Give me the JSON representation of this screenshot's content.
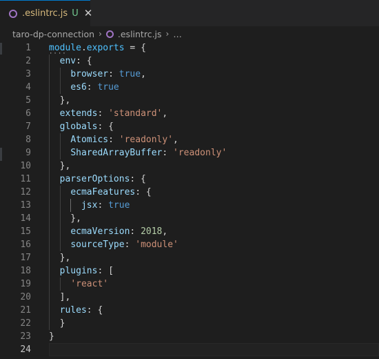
{
  "tab": {
    "icon": "eslint-circle-icon",
    "filename": ".eslintrc.js",
    "status": "U",
    "close_glyph": "✕",
    "color": "#d7ba7d"
  },
  "breadcrumb": {
    "folder": "taro-dp-connection",
    "file": ".eslintrc.js",
    "more": "…",
    "sep": "›"
  },
  "editor": {
    "current_line": 24,
    "lines": [
      {
        "n": "1",
        "tokens": [
          {
            "t": "module",
            "c": "v"
          },
          {
            "t": ".",
            "c": "w"
          },
          {
            "t": "exports",
            "c": "v"
          },
          {
            "t": " = {",
            "c": "w"
          }
        ]
      },
      {
        "n": "2",
        "tokens": [
          {
            "t": "  ",
            "c": "w"
          },
          {
            "t": "env",
            "c": "k"
          },
          {
            "t": ": {",
            "c": "w"
          }
        ]
      },
      {
        "n": "3",
        "tokens": [
          {
            "t": "    ",
            "c": "w"
          },
          {
            "t": "browser",
            "c": "k"
          },
          {
            "t": ": ",
            "c": "w"
          },
          {
            "t": "true",
            "c": "b"
          },
          {
            "t": ",",
            "c": "w"
          }
        ]
      },
      {
        "n": "4",
        "tokens": [
          {
            "t": "    ",
            "c": "w"
          },
          {
            "t": "es6",
            "c": "k"
          },
          {
            "t": ": ",
            "c": "w"
          },
          {
            "t": "true",
            "c": "b"
          }
        ]
      },
      {
        "n": "5",
        "tokens": [
          {
            "t": "  },",
            "c": "w"
          }
        ]
      },
      {
        "n": "6",
        "tokens": [
          {
            "t": "  ",
            "c": "w"
          },
          {
            "t": "extends",
            "c": "k"
          },
          {
            "t": ": ",
            "c": "w"
          },
          {
            "t": "'standard'",
            "c": "s"
          },
          {
            "t": ",",
            "c": "w"
          }
        ]
      },
      {
        "n": "7",
        "tokens": [
          {
            "t": "  ",
            "c": "w"
          },
          {
            "t": "globals",
            "c": "k"
          },
          {
            "t": ": {",
            "c": "w"
          }
        ]
      },
      {
        "n": "8",
        "tokens": [
          {
            "t": "    ",
            "c": "w"
          },
          {
            "t": "Atomics",
            "c": "k"
          },
          {
            "t": ": ",
            "c": "w"
          },
          {
            "t": "'readonly'",
            "c": "s"
          },
          {
            "t": ",",
            "c": "w"
          }
        ]
      },
      {
        "n": "9",
        "tokens": [
          {
            "t": "    ",
            "c": "w"
          },
          {
            "t": "SharedArrayBuffer",
            "c": "k"
          },
          {
            "t": ": ",
            "c": "w"
          },
          {
            "t": "'readonly'",
            "c": "s"
          }
        ]
      },
      {
        "n": "10",
        "tokens": [
          {
            "t": "  },",
            "c": "w"
          }
        ]
      },
      {
        "n": "11",
        "tokens": [
          {
            "t": "  ",
            "c": "w"
          },
          {
            "t": "parserOptions",
            "c": "k"
          },
          {
            "t": ": {",
            "c": "w"
          }
        ]
      },
      {
        "n": "12",
        "tokens": [
          {
            "t": "    ",
            "c": "w"
          },
          {
            "t": "ecmaFeatures",
            "c": "k"
          },
          {
            "t": ": {",
            "c": "w"
          }
        ]
      },
      {
        "n": "13",
        "tokens": [
          {
            "t": "      ",
            "c": "w"
          },
          {
            "t": "jsx",
            "c": "k"
          },
          {
            "t": ": ",
            "c": "w"
          },
          {
            "t": "true",
            "c": "b"
          }
        ]
      },
      {
        "n": "14",
        "tokens": [
          {
            "t": "    },",
            "c": "w"
          }
        ]
      },
      {
        "n": "15",
        "tokens": [
          {
            "t": "    ",
            "c": "w"
          },
          {
            "t": "ecmaVersion",
            "c": "k"
          },
          {
            "t": ": ",
            "c": "w"
          },
          {
            "t": "2018",
            "c": "n"
          },
          {
            "t": ",",
            "c": "w"
          }
        ]
      },
      {
        "n": "16",
        "tokens": [
          {
            "t": "    ",
            "c": "w"
          },
          {
            "t": "sourceType",
            "c": "k"
          },
          {
            "t": ": ",
            "c": "w"
          },
          {
            "t": "'module'",
            "c": "s"
          }
        ]
      },
      {
        "n": "17",
        "tokens": [
          {
            "t": "  },",
            "c": "w"
          }
        ]
      },
      {
        "n": "18",
        "tokens": [
          {
            "t": "  ",
            "c": "w"
          },
          {
            "t": "plugins",
            "c": "k"
          },
          {
            "t": ": [",
            "c": "w"
          }
        ]
      },
      {
        "n": "19",
        "tokens": [
          {
            "t": "    ",
            "c": "w"
          },
          {
            "t": "'react'",
            "c": "s"
          }
        ]
      },
      {
        "n": "20",
        "tokens": [
          {
            "t": "  ],",
            "c": "w"
          }
        ]
      },
      {
        "n": "21",
        "tokens": [
          {
            "t": "  ",
            "c": "w"
          },
          {
            "t": "rules",
            "c": "k"
          },
          {
            "t": ": {",
            "c": "w"
          }
        ]
      },
      {
        "n": "22",
        "tokens": [
          {
            "t": "  }",
            "c": "w"
          }
        ]
      },
      {
        "n": "23",
        "tokens": [
          {
            "t": "}",
            "c": "w"
          }
        ]
      },
      {
        "n": "24",
        "tokens": []
      }
    ]
  },
  "colors": {
    "background": "#1e1e1e",
    "tabbar": "#252526",
    "accent": "#007acc",
    "eslint_icon": "#a074c4",
    "untracked": "#73c991"
  }
}
